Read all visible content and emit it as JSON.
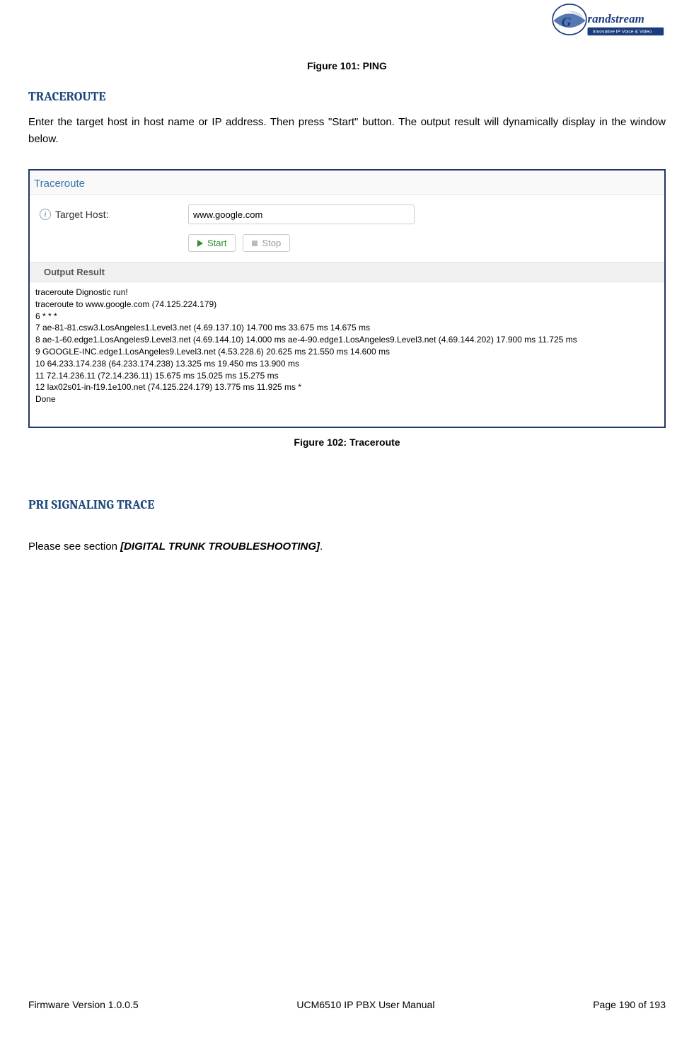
{
  "logo": {
    "brand": "Grandstream",
    "tagline": "Innovative IP Voice & Video"
  },
  "figure101": "Figure 101: PING",
  "section1": {
    "heading": "TRACEROUTE",
    "body": "Enter the target host in host name or IP address. Then press \"Start\" button. The output result will dynamically display in the window below."
  },
  "screenshot": {
    "panel_title": "Traceroute",
    "target_label": "Target Host:",
    "target_value": "www.google.com",
    "start_label": "Start",
    "stop_label": "Stop",
    "subheader": "Output Result",
    "output_lines": [
      "traceroute Dignostic run!",
      "traceroute to www.google.com (74.125.224.179)",
      "6 * * *",
      "7 ae-81-81.csw3.LosAngeles1.Level3.net (4.69.137.10) 14.700 ms 33.675 ms 14.675 ms",
      "8 ae-1-60.edge1.LosAngeles9.Level3.net (4.69.144.10) 14.000 ms ae-4-90.edge1.LosAngeles9.Level3.net (4.69.144.202) 17.900 ms 11.725 ms",
      "9 GOOGLE-INC.edge1.LosAngeles9.Level3.net (4.53.228.6) 20.625 ms 21.550 ms 14.600 ms",
      "10 64.233.174.238 (64.233.174.238) 13.325 ms 19.450 ms 13.900 ms",
      "11 72.14.236.11 (72.14.236.11) 15.675 ms 15.025 ms 15.275 ms",
      "12 lax02s01-in-f19.1e100.net (74.125.224.179) 13.775 ms 11.925 ms *",
      "Done"
    ]
  },
  "figure102": "Figure 102: Traceroute",
  "section2": {
    "heading": "PRI SIGNALING TRACE",
    "body_prefix": "Please see section ",
    "body_ref": "[DIGITAL TRUNK TROUBLESHOOTING]",
    "body_suffix": "."
  },
  "footer": {
    "left": "Firmware Version 1.0.0.5",
    "center": "UCM6510 IP PBX User Manual",
    "right": "Page 190 of 193"
  }
}
